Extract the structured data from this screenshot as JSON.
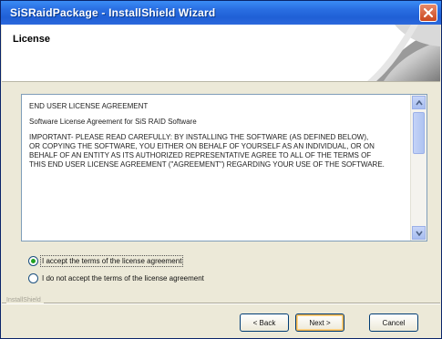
{
  "window": {
    "title": "SiSRaidPackage - InstallShield Wizard"
  },
  "header": {
    "title": "License"
  },
  "license": {
    "paragraphs": [
      "END USER LICENSE AGREEMENT",
      "Software License Agreement for SiS RAID Software",
      "IMPORTANT- PLEASE READ CAREFULLY: BY INSTALLING THE SOFTWARE (AS DEFINED BELOW),",
      "OR COPYING THE SOFTWARE, YOU EITHER ON BEHALF OF YOURSELF AS AN INDIVIDUAL, OR ON",
      "BEHALF OF AN ENTITY AS ITS AUTHORIZED REPRESENTATIVE AGREE TO ALL OF THE TERMS OF",
      "THIS END USER LICENSE AGREEMENT (\"AGREEMENT\") REGARDING YOUR USE OF THE SOFTWARE."
    ]
  },
  "options": {
    "accept": "I accept the terms of the license agreement",
    "decline": "I do not accept the terms of the license agreement",
    "selected": "accept"
  },
  "footer": {
    "brand": "InstallShield"
  },
  "buttons": {
    "back": "< Back",
    "next": "Next >",
    "cancel": "Cancel"
  }
}
